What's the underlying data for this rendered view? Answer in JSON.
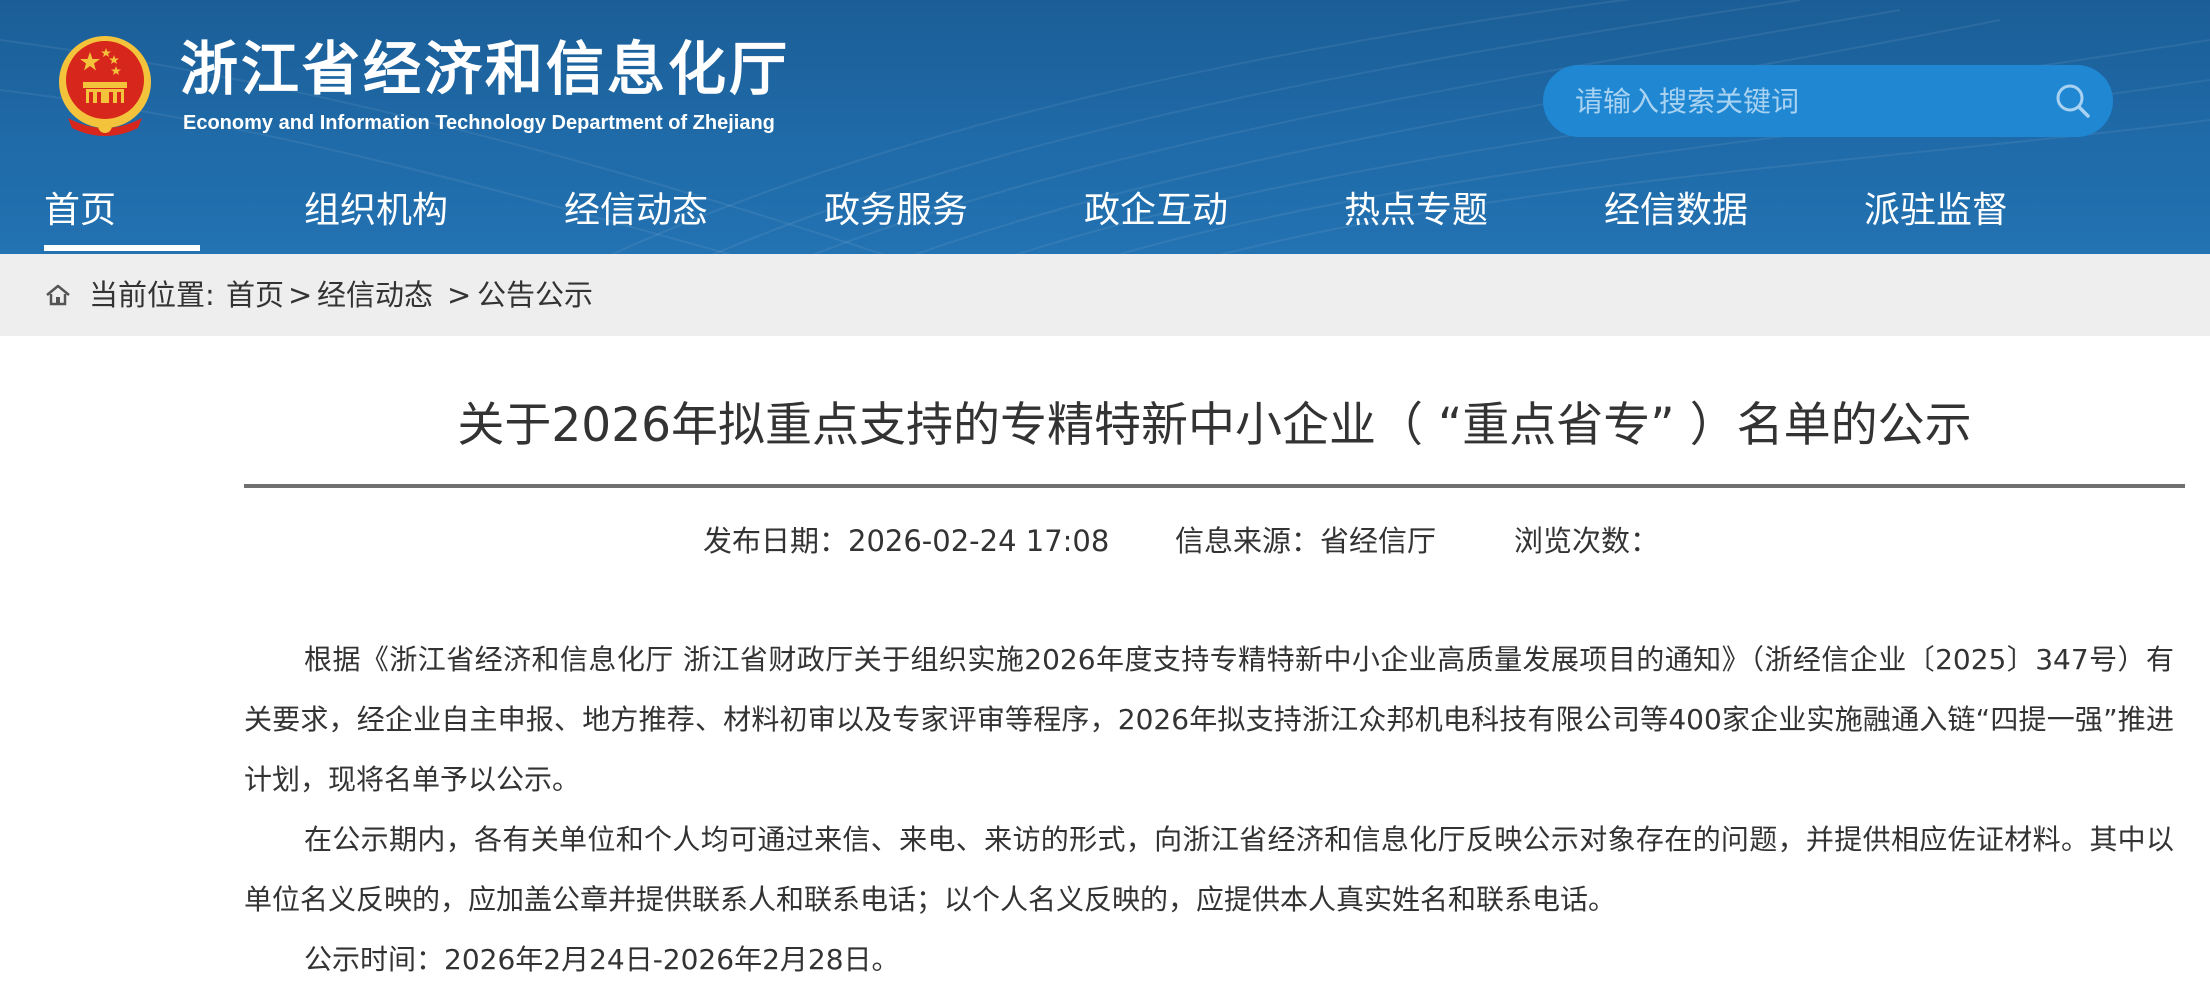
{
  "header": {
    "site_name_zh": "浙江省经济和信息化厅",
    "site_name_en": "Economy and Information Technology Department of Zhejiang",
    "search_placeholder": "请输入搜索关键词"
  },
  "nav": {
    "items": [
      {
        "label": "首页",
        "active": true
      },
      {
        "label": "组织机构"
      },
      {
        "label": "经信动态"
      },
      {
        "label": "政务服务"
      },
      {
        "label": "政企互动"
      },
      {
        "label": "热点专题"
      },
      {
        "label": "经信数据"
      },
      {
        "label": "派驻监督"
      }
    ]
  },
  "breadcrumb": {
    "prefix": "当前位置:",
    "home": "首页",
    "sep1": ">",
    "section": "经信动态",
    "sep2": ">",
    "current": "公告公示"
  },
  "article": {
    "title": "关于2026年拟重点支持的专精特新中小企业（ “重点省专” ）名单的公示",
    "publish_date": "发布日期：2026-02-24 17:08",
    "source": "信息来源：省经信厅",
    "views": "浏览次数：",
    "paragraphs": [
      "根据《浙江省经济和信息化厅 浙江省财政厅关于组织实施2026年度支持专精特新中小企业高质量发展项目的通知》（浙经信企业〔2025〕347号）有关要求，经企业自主申报、地方推荐、材料初审以及专家评审等程序，2026年拟支持浙江众邦机电科技有限公司等400家企业实施融通入链“四提一强”推进计划，现将名单予以公示。",
      "在公示期内，各有关单位和个人均可通过来信、来电、来访的形式，向浙江省经济和信息化厅反映公示对象存在的问题，并提供相应佐证材料。其中以单位名义反映的，应加盖公章并提供联系人和联系电话；以个人名义反映的，应提供本人真实姓名和联系电话。",
      "公示时间：2026年2月24日-2026年2月28日。"
    ]
  },
  "colors": {
    "header_blue": "#1f6aa8",
    "search_blue": "#2087d2",
    "breadcrumb_bg": "#eeeeee",
    "text": "#333333",
    "emblem_red": "#d7261c",
    "emblem_gold": "#f3c33b"
  },
  "icons": {
    "emblem": "national-emblem-icon",
    "search": "search-icon",
    "home": "home-icon"
  }
}
